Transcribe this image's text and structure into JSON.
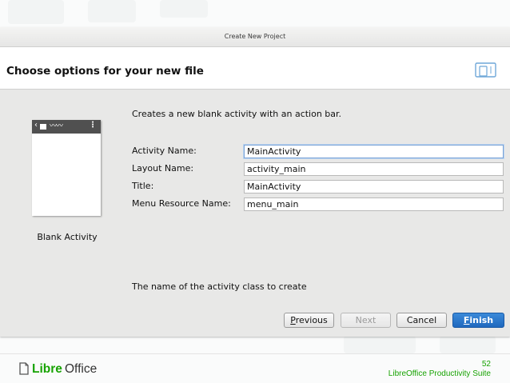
{
  "dialog": {
    "title": "Create New Project",
    "header_title": "Choose options for your new file",
    "device_icon": "tablet-phone-icon"
  },
  "template": {
    "name": "Blank Activity",
    "preview_icons": [
      "back-arrow-icon",
      "app-icon",
      "overflow-menu-icon"
    ]
  },
  "form": {
    "description": "Creates a new blank activity with an action bar.",
    "fields": [
      {
        "label": "Activity Name:",
        "value": "MainActivity"
      },
      {
        "label": "Layout Name:",
        "value": "activity_main"
      },
      {
        "label": "Title:",
        "value": "MainActivity"
      },
      {
        "label": "Menu Resource Name:",
        "value": "menu_main"
      }
    ],
    "hint": "The name of the activity class to create"
  },
  "buttons": {
    "previous_mnemonic": "P",
    "previous_rest": "revious",
    "next": "Next",
    "cancel": "Cancel",
    "finish_mnemonic": "F",
    "finish_rest": "inish"
  },
  "footer": {
    "logo_libre": "Libre",
    "logo_office": "Office",
    "page_number": "52",
    "suite": "LibreOffice Productivity Suite"
  },
  "colors": {
    "accent": "#1f68be",
    "brand_green": "#18a303"
  }
}
